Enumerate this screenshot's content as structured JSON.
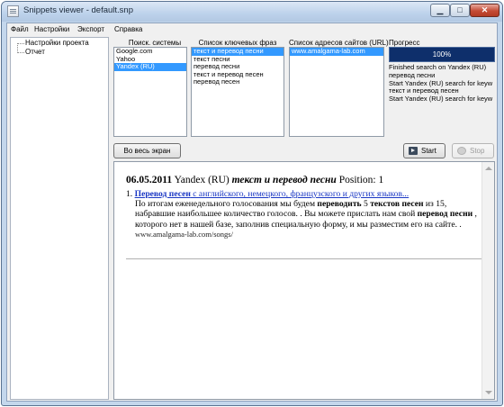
{
  "window": {
    "title": "Snippets viewer - default.snp",
    "minimize_glyph": "▁",
    "maximize_glyph": "□",
    "close_glyph": "✕"
  },
  "menu": [
    "Файл",
    "Настройки",
    "Экспорт",
    "Справка"
  ],
  "tree": {
    "items": [
      "Настройки проекта",
      "Отчет"
    ]
  },
  "columns": {
    "engines": {
      "header": "Поиск. системы",
      "items": [
        "Google.com",
        "Yahoo",
        "Yandex (RU)"
      ],
      "selected": "Yandex (RU)"
    },
    "keywords": {
      "header": "Список ключевых фраз",
      "items": [
        "текст и перевод песни",
        "текст песни",
        "перевод песни",
        "текст и перевод песен",
        "перевод песен"
      ],
      "selected": "текст и перевод песни"
    },
    "sites": {
      "header": "Список адресов сайтов (URL)",
      "items": [
        "www.amalgama-lab.com"
      ],
      "selected": "www.amalgama-lab.com"
    },
    "progress": {
      "header": "Прогресс",
      "value": 1.0,
      "label": "100%"
    }
  },
  "log": [
    "Finished search on Yandex (RU)",
    "перевод песни",
    "Start Yandex (RU) search for keyw",
    "текст и перевод песен",
    "Start Yandex (RU) search for keyw"
  ],
  "buttons": {
    "fullscreen": "Во весь экран",
    "start": "Start",
    "stop": "Stop"
  },
  "result": {
    "date": "06.05.2011",
    "engine": "Yandex (RU)",
    "keyword": "текст и перевод песни",
    "position_label": "Position:",
    "position": "1",
    "item_number": "1.",
    "title_bold": "Перевод песен",
    "title_rest": " с английского, немецкого, французского и других языков...",
    "snippet_parts": [
      {
        "text": "По итогам еженедельного голосования мы будем ",
        "bold": false
      },
      {
        "text": "переводить",
        "bold": true
      },
      {
        "text": " 5 ",
        "bold": false
      },
      {
        "text": "текстов песен",
        "bold": true
      },
      {
        "text": " из 15, набравшие наибольшее количество голосов. . Вы можете прислать нам свой ",
        "bold": false
      },
      {
        "text": "перевод песни",
        "bold": true
      },
      {
        "text": " , которого нет в нашей базе, заполнив специальную форму, и мы разместим его на сайте. .",
        "bold": false
      }
    ],
    "url": "www.amalgama-lab.com/songs/"
  },
  "colors": {
    "selection": "#3399ff",
    "progress_bg": "#0e2f6b",
    "link": "#1a37c4"
  }
}
